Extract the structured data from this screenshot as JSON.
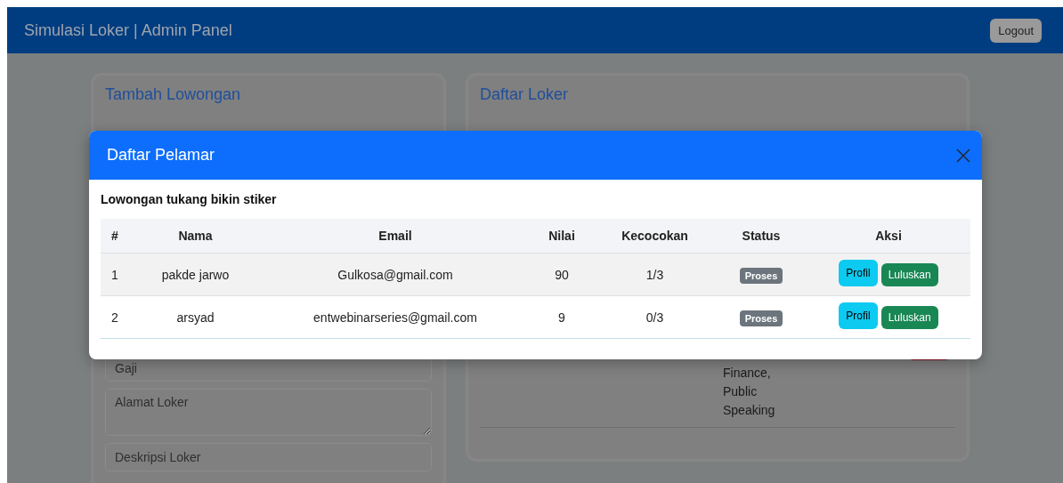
{
  "navbar": {
    "title": "Simulasi Loker | Admin Panel",
    "logout_button": "Logout"
  },
  "form_card": {
    "title": "Tambah Lowongan",
    "fields": [
      {
        "placeholder": "Gaji",
        "kind": "input"
      },
      {
        "placeholder": "Alamat Loker",
        "kind": "textarea"
      },
      {
        "placeholder": "Deskripsi Loker",
        "kind": "input"
      }
    ]
  },
  "list_card": {
    "title": "Daftar Loker",
    "skill_lines": [
      "Finance,",
      "Public",
      "Speaking"
    ]
  },
  "modal": {
    "title": "Daftar Pelamar",
    "subtitle": "Lowongan tukang bikin stiker",
    "columns": [
      "#",
      "Nama",
      "Email",
      "Nilai",
      "Kecocokan",
      "Status",
      "Aksi"
    ],
    "rows": [
      {
        "no": "1",
        "name": "pakde jarwo",
        "email": "Gulkosa@gmail.com",
        "score": "90",
        "match": "1/3",
        "status": "Proses",
        "actions": [
          {
            "label": "Profil",
            "kind": "info"
          },
          {
            "label": "Luluskan",
            "kind": "success"
          }
        ]
      },
      {
        "no": "2",
        "name": "arsyad",
        "email": "entwebinarseries@gmail.com",
        "score": "9",
        "match": "0/3",
        "status": "Proses",
        "actions": [
          {
            "label": "Profil",
            "kind": "info"
          },
          {
            "label": "Luluskan",
            "kind": "success"
          }
        ]
      }
    ]
  }
}
